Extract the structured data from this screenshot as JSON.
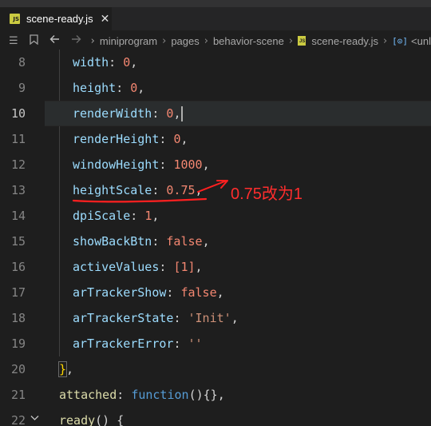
{
  "tab": {
    "badge": "JS",
    "title": "scene-ready.js",
    "close": "✕"
  },
  "breadcrumb": {
    "list_icon": "list-icon",
    "bookmark_icon": "bookmark-icon",
    "back_icon": "arrow-left-icon",
    "forward_icon": "arrow-right-icon",
    "items": [
      "miniprogram",
      "pages",
      "behavior-scene",
      "scene-ready.js"
    ],
    "symbol_icon": "[⊙]",
    "symbol_label": "<unl"
  },
  "editor": {
    "lines": [
      {
        "num": "8",
        "key": "width",
        "colon": ": ",
        "value": "0",
        "tail": ","
      },
      {
        "num": "9",
        "key": "height",
        "colon": ": ",
        "value": "0",
        "tail": ","
      },
      {
        "num": "10",
        "key": "renderWidth",
        "colon": ": ",
        "value": "0",
        "tail": ","
      },
      {
        "num": "11",
        "key": "renderHeight",
        "colon": ": ",
        "value": "0",
        "tail": ","
      },
      {
        "num": "12",
        "key": "windowHeight",
        "colon": ": ",
        "value": "1000",
        "tail": ","
      },
      {
        "num": "13",
        "key": "heightScale",
        "colon": ": ",
        "value": "0.75",
        "tail": ","
      },
      {
        "num": "14",
        "key": "dpiScale",
        "colon": ": ",
        "value": "1",
        "tail": ","
      },
      {
        "num": "15",
        "key": "showBackBtn",
        "colon": ": ",
        "value": "false",
        "tail": ","
      },
      {
        "num": "16",
        "key": "activeValues",
        "colon": ": ",
        "value": "[1]",
        "tail": ","
      },
      {
        "num": "17",
        "key": "arTrackerShow",
        "colon": ": ",
        "value": "false",
        "tail": ","
      },
      {
        "num": "18",
        "key": "arTrackerState",
        "colon": ": ",
        "value": "'Init'",
        "tail": ","
      },
      {
        "num": "19",
        "key": "arTrackerError",
        "colon": ": ",
        "value": "''",
        "tail": ""
      }
    ],
    "line20": {
      "num": "20",
      "brace": "}",
      "tail": ","
    },
    "line21": {
      "num": "21",
      "key": "attached",
      "colon": ": ",
      "func": "function",
      "rest": "(){}",
      "tail": ","
    },
    "line22": {
      "num": "22",
      "name": "ready",
      "rest": "() {"
    },
    "current_line": "10"
  },
  "annotation": {
    "text": "0.75改为1",
    "color": "#ff2d2d"
  }
}
